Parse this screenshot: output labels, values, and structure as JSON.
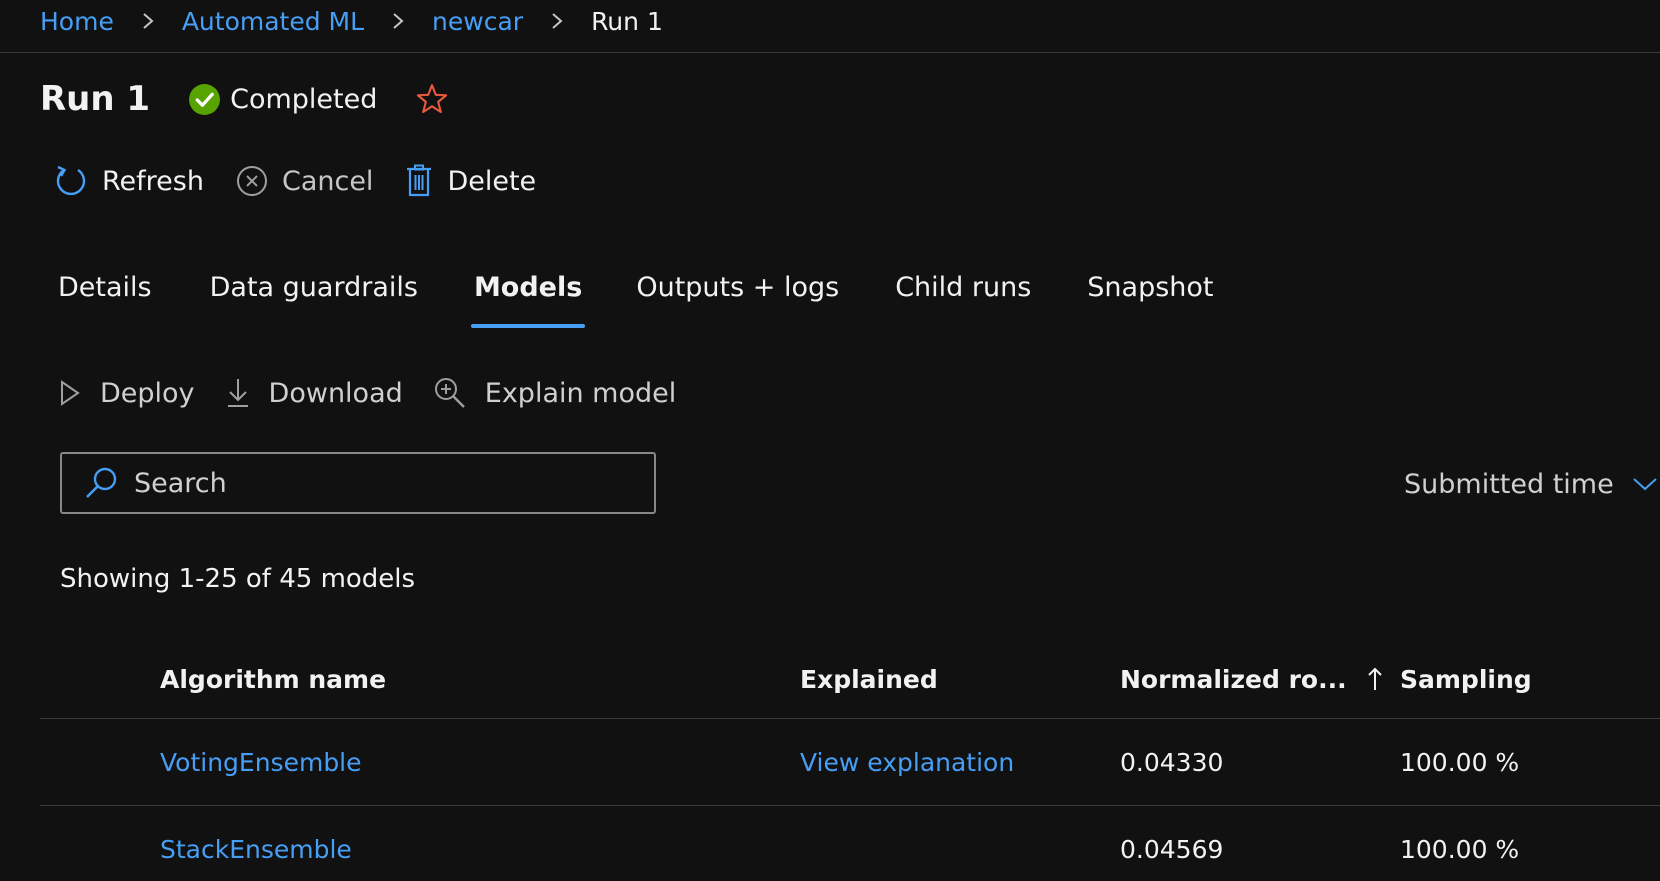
{
  "breadcrumb": {
    "items": [
      "Home",
      "Automated ML",
      "newcar",
      "Run 1"
    ]
  },
  "header": {
    "title": "Run 1",
    "status": "Completed",
    "status_color": "#57a300",
    "favorite_color": "#e6593c"
  },
  "commands": {
    "refresh": "Refresh",
    "cancel": "Cancel",
    "delete": "Delete"
  },
  "tabs": [
    {
      "label": "Details",
      "active": false
    },
    {
      "label": "Data guardrails",
      "active": false
    },
    {
      "label": "Models",
      "active": true
    },
    {
      "label": "Outputs + logs",
      "active": false
    },
    {
      "label": "Child runs",
      "active": false
    },
    {
      "label": "Snapshot",
      "active": false
    }
  ],
  "model_commands": {
    "deploy": "Deploy",
    "download": "Download",
    "explain": "Explain model"
  },
  "search": {
    "placeholder": "Search",
    "value": ""
  },
  "sort": {
    "selected": "Submitted time"
  },
  "summary": "Showing 1-25 of 45 models",
  "table": {
    "columns": [
      "Algorithm name",
      "Explained",
      "Normalized ro...",
      "Sampling"
    ],
    "rows": [
      {
        "algorithm": "VotingEnsemble",
        "explained": "View explanation",
        "score": "0.04330",
        "sampling": "100.00 %"
      },
      {
        "algorithm": "StackEnsemble",
        "explained": "",
        "score": "0.04569",
        "sampling": "100.00 %"
      }
    ]
  },
  "accent_color": "#479ef5"
}
